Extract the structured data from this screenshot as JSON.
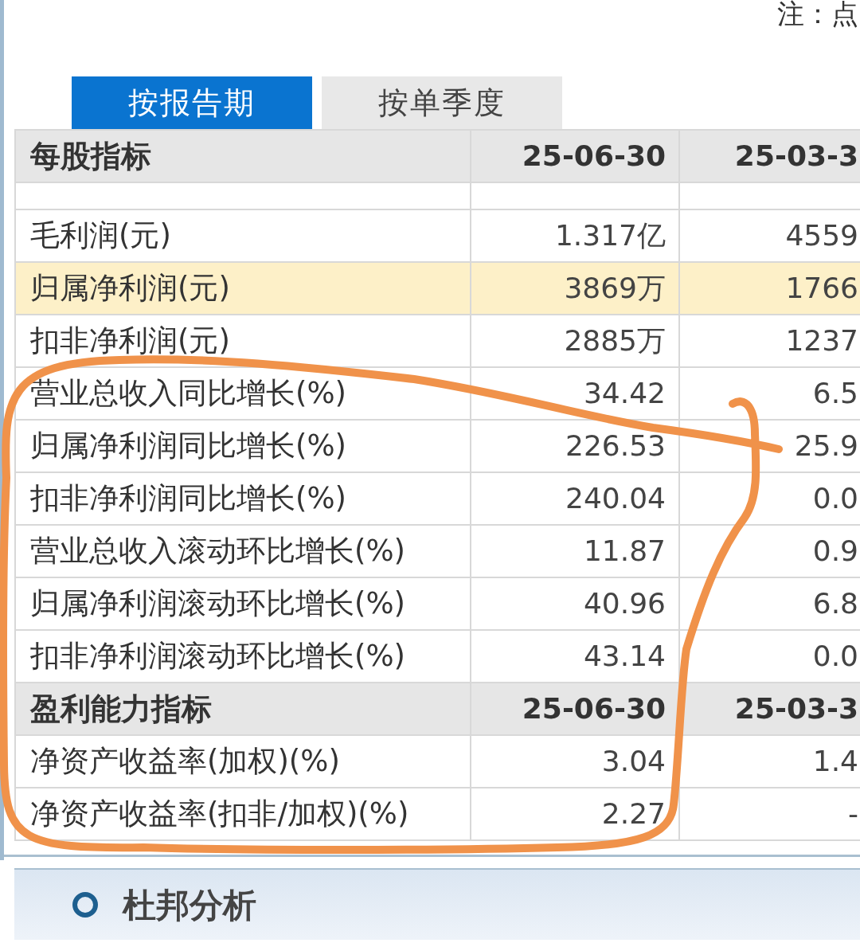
{
  "note": "注：点",
  "tabs": [
    {
      "label": "按报告期",
      "selected": true
    },
    {
      "label": "按单季度",
      "selected": false
    }
  ],
  "sections": [
    {
      "title": "每股指标",
      "dates": [
        "25-06-30",
        "25-03-3"
      ],
      "partial_row": true,
      "rows": [
        {
          "label": "毛利润(元)",
          "values": [
            "1.317亿",
            "4559"
          ],
          "highlighted": false
        },
        {
          "label": "归属净利润(元)",
          "values": [
            "3869万",
            "1766"
          ],
          "highlighted": true
        },
        {
          "label": "扣非净利润(元)",
          "values": [
            "2885万",
            "1237"
          ],
          "highlighted": false
        },
        {
          "label": "营业总收入同比增长(%)",
          "values": [
            "34.42",
            "6.5"
          ],
          "highlighted": false
        },
        {
          "label": "归属净利润同比增长(%)",
          "values": [
            "226.53",
            "25.9"
          ],
          "highlighted": false
        },
        {
          "label": "扣非净利润同比增长(%)",
          "values": [
            "240.04",
            "0.0"
          ],
          "highlighted": false
        },
        {
          "label": "营业总收入滚动环比增长(%)",
          "values": [
            "11.87",
            "0.9"
          ],
          "highlighted": false
        },
        {
          "label": "归属净利润滚动环比增长(%)",
          "values": [
            "40.96",
            "6.8"
          ],
          "highlighted": false
        },
        {
          "label": "扣非净利润滚动环比增长(%)",
          "values": [
            "43.14",
            "0.0"
          ],
          "highlighted": false
        }
      ]
    },
    {
      "title": "盈利能力指标",
      "dates": [
        "25-06-30",
        "25-03-3"
      ],
      "rows": [
        {
          "label": "净资产收益率(加权)(%)",
          "values": [
            "3.04",
            "1.4"
          ],
          "highlighted": false
        },
        {
          "label": "净资产收益率(扣非/加权)(%)",
          "values": [
            "2.27",
            "-"
          ],
          "highlighted": false
        }
      ]
    }
  ],
  "next_section": {
    "title": "杜邦分析"
  },
  "annotation": {
    "kind": "freehand-loop"
  }
}
